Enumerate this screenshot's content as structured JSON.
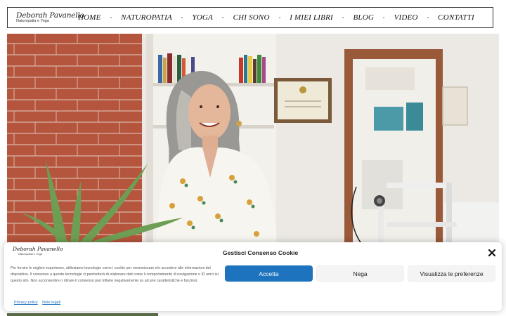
{
  "header": {
    "logo_name": "Deborah Pavanello",
    "logo_subtitle": "Naturopatia e Yoga",
    "nav": [
      {
        "label": "HOME"
      },
      {
        "label": "NATUROPATIA"
      },
      {
        "label": "YOGA"
      },
      {
        "label": "CHI SONO"
      },
      {
        "label": "I MIEI LIBRI"
      },
      {
        "label": "BLOG"
      },
      {
        "label": "VIDEO"
      },
      {
        "label": "CONTATTI"
      }
    ]
  },
  "hero": {
    "image_name": "hero-photo"
  },
  "cookie_banner": {
    "logo_name": "Deborah Pavanello",
    "logo_subtitle": "Naturopatia e Yoga",
    "title": "Gestisci Consenso Cookie",
    "text": "Per fornire le migliori esperienze, utilizziamo tecnologie come i cookie per memorizzare e/o accedere alle informazioni del dispositivo. Il consenso a queste tecnologie ci permetterà di elaborare dati come il comportamento di navigazione o ID unici su questo sito. Non acconsentire o ritirare il consenso può influire negativamente su alcune caratteristiche e funzioni.",
    "accept_label": "Accetta",
    "deny_label": "Nega",
    "prefs_label": "Visualizza le preferenze",
    "link_privacy": "Privacy policy",
    "link_legal": "Note legali",
    "accent_color": "#1e73be"
  }
}
